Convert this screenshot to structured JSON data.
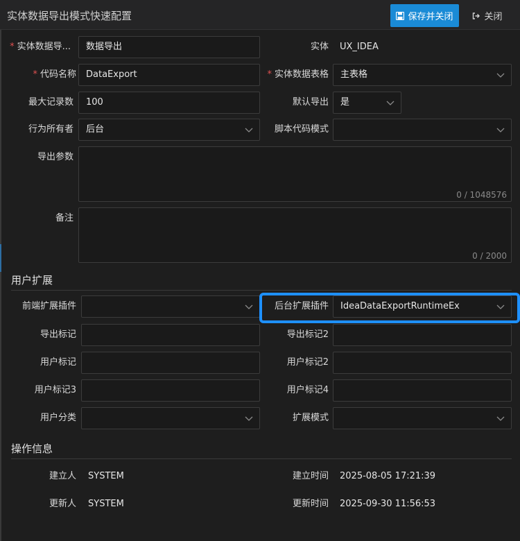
{
  "header": {
    "title": "实体数据导出模式快速配置",
    "save_label": "保存并关闭",
    "close_label": "关闭"
  },
  "form": {
    "name_label": "实体数据导...",
    "name_value": "数据导出",
    "entity_label": "实体",
    "entity_value": "UX_IDEA",
    "code_label": "代码名称",
    "code_value": "DataExport",
    "table_label": "实体数据表格",
    "table_value": "主表格",
    "max_label": "最大记录数",
    "max_value": "100",
    "default_label": "默认导出",
    "default_value": "是",
    "owner_label": "行为所有者",
    "owner_value": "后台",
    "script_label": "脚本代码模式",
    "script_value": "",
    "params_label": "导出参数",
    "params_counter": "0 / 1048576",
    "memo_label": "备注",
    "memo_counter": "0 / 2000"
  },
  "user_ext": {
    "section_title": "用户扩展",
    "front_plugin_label": "前端扩展插件",
    "front_plugin_value": "",
    "back_plugin_label": "后台扩展插件",
    "back_plugin_value": "IdeaDataExportRuntimeEx",
    "export_tag_label": "导出标记",
    "export_tag2_label": "导出标记2",
    "user_tag_label": "用户标记",
    "user_tag2_label": "用户标记2",
    "user_tag3_label": "用户标记3",
    "user_tag4_label": "用户标记4",
    "user_cat_label": "用户分类",
    "ext_mode_label": "扩展模式"
  },
  "op_info": {
    "section_title": "操作信息",
    "creator_label": "建立人",
    "creator_value": "SYSTEM",
    "created_label": "建立时间",
    "created_value": "2025-08-05 17:21:39",
    "updater_label": "更新人",
    "updater_value": "SYSTEM",
    "updated_label": "更新时间",
    "updated_value": "2025-09-30 11:56:53"
  },
  "colors": {
    "accent": "#1a8bd6",
    "highlight": "#1e90ff",
    "required": "#e05151",
    "background": "#1e1e1e"
  }
}
